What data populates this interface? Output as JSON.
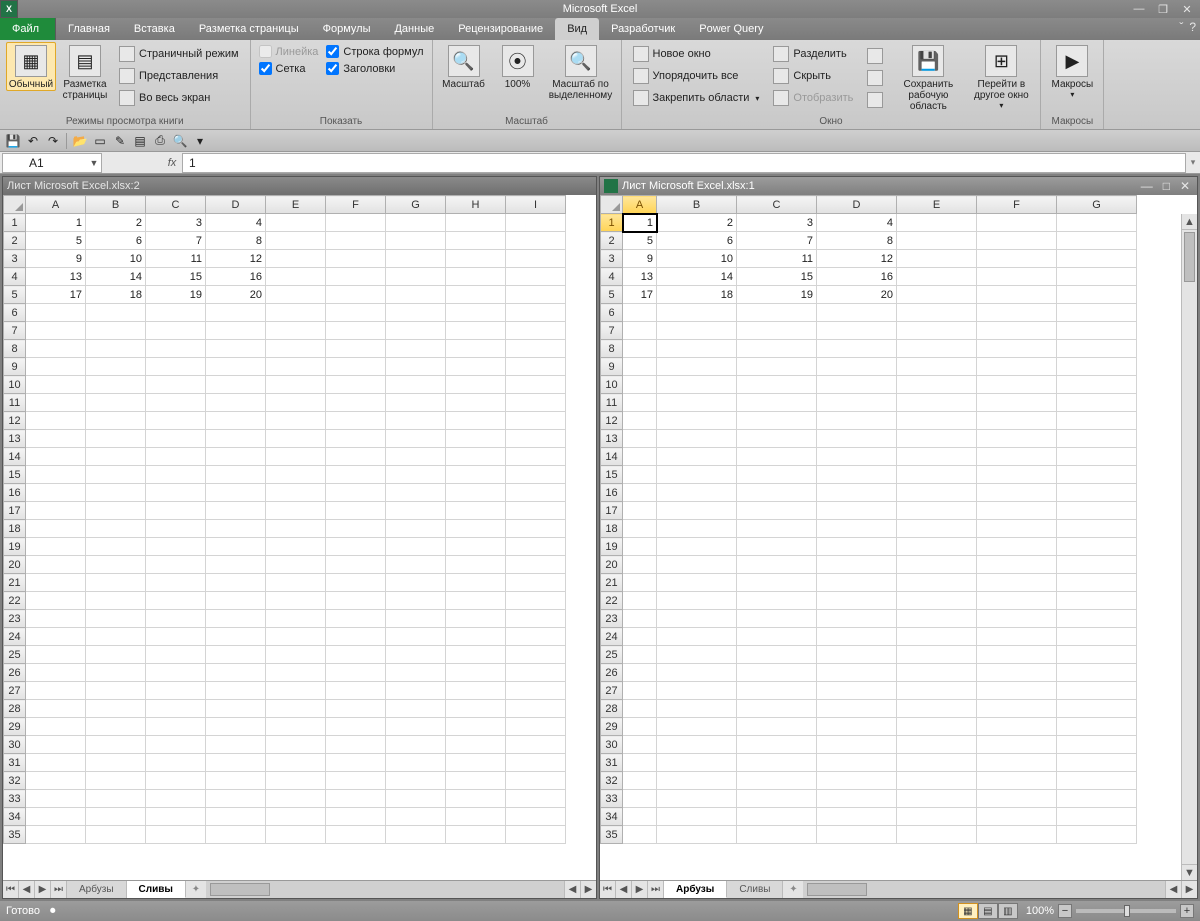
{
  "app_title": "Microsoft Excel",
  "tabs": {
    "file": "Файл",
    "items": [
      "Главная",
      "Вставка",
      "Разметка страницы",
      "Формулы",
      "Данные",
      "Рецензирование",
      "Вид",
      "Разработчик",
      "Power Query"
    ],
    "active": "Вид"
  },
  "ribbon": {
    "group_views": {
      "label": "Режимы просмотра книги",
      "normal": "Обычный",
      "page_layout": "Разметка\nстраницы",
      "page_break": "Страничный режим",
      "views": "Представления",
      "fullscreen": "Во весь экран"
    },
    "group_show": {
      "label": "Показать",
      "ruler": "Линейка",
      "gridlines": "Сетка",
      "formulabar": "Строка формул",
      "headings": "Заголовки",
      "ruler_checked": false,
      "gridlines_checked": true,
      "formulabar_checked": true,
      "headings_checked": true
    },
    "group_zoom": {
      "label": "Масштаб",
      "zoom": "Масштаб",
      "z100": "100%",
      "zoom_sel": "Масштаб по\nвыделенному"
    },
    "group_window": {
      "label": "Окно",
      "new_window": "Новое окно",
      "arrange": "Упорядочить все",
      "freeze": "Закрепить области",
      "split": "Разделить",
      "hide": "Скрыть",
      "unhide": "Отобразить",
      "save_ws": "Сохранить\nрабочую область",
      "switch": "Перейти в\nдругое окно"
    },
    "group_macros": {
      "label": "Макросы",
      "macros": "Макросы"
    }
  },
  "namebox": "A1",
  "formula_value": "1",
  "panes": {
    "left": {
      "title": "Лист Microsoft Excel.xlsx:2",
      "columns": [
        "A",
        "B",
        "C",
        "D",
        "E",
        "F",
        "G",
        "H",
        "I"
      ],
      "rows": 35,
      "data": [
        [
          1,
          2,
          3,
          4
        ],
        [
          5,
          6,
          7,
          8
        ],
        [
          9,
          10,
          11,
          12
        ],
        [
          13,
          14,
          15,
          16
        ],
        [
          17,
          18,
          19,
          20
        ]
      ],
      "tabs": [
        "Арбузы",
        "Сливы"
      ],
      "active_tab": "Сливы"
    },
    "right": {
      "title": "Лист Microsoft Excel.xlsx:1",
      "columns": [
        "A",
        "B",
        "C",
        "D",
        "E",
        "F",
        "G"
      ],
      "rows": 35,
      "data": [
        [
          1,
          2,
          3,
          4
        ],
        [
          5,
          6,
          7,
          8
        ],
        [
          9,
          10,
          11,
          12
        ],
        [
          13,
          14,
          15,
          16
        ],
        [
          17,
          18,
          19,
          20
        ]
      ],
      "tabs": [
        "Арбузы",
        "Сливы"
      ],
      "active_tab": "Арбузы",
      "selected_cell": "A1"
    }
  },
  "statusbar": {
    "ready": "Готово",
    "zoom": "100%"
  }
}
